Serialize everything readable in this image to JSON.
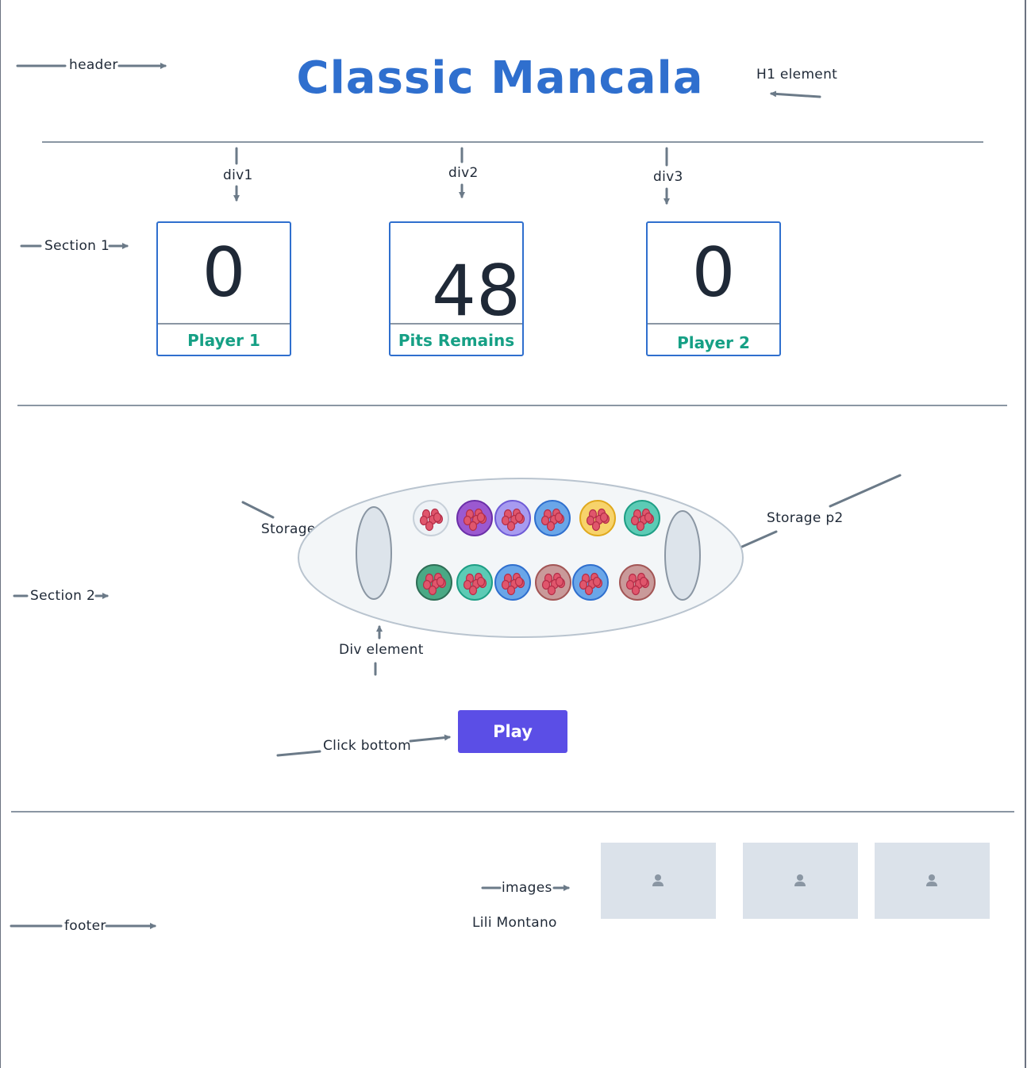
{
  "header": {
    "label": "header",
    "title": "Classic Mancala",
    "title_annotation": "H1 element"
  },
  "section1": {
    "label": "Section 1",
    "cards": [
      {
        "annotation": "div1",
        "value": "0",
        "caption": "Player 1"
      },
      {
        "annotation": "div2",
        "value": "48",
        "caption": "Pits Remains"
      },
      {
        "annotation": "div3",
        "value": "0",
        "caption": "Player 2"
      }
    ]
  },
  "section2": {
    "label": "Section 2",
    "storage_p1": "Storage p1",
    "storage_p2": "Storage p2",
    "board_annotation": "Div element",
    "button_annotation": "Click bottom",
    "play_label": "Play",
    "top_row_pits": [
      "white",
      "purple",
      "lavender",
      "blue",
      "yellow",
      "teal"
    ],
    "bottom_row_pits": [
      "green",
      "teal",
      "blue",
      "rose",
      "blue",
      "rose"
    ]
  },
  "footer": {
    "label": "footer",
    "images_label": "images",
    "author": "Lili Montano",
    "image_icons": [
      "user-icon",
      "user-icon",
      "user-icon"
    ]
  },
  "colors": {
    "title": "#2f6fce",
    "card_border": "#2f6fce",
    "caption": "#16a085",
    "play_button": "#5b4ee6",
    "arrow": "#6b7a88",
    "pit_white": "#eef2f6",
    "pit_purple": "#9b59d0",
    "pit_lavender": "#a79bf0",
    "pit_blue": "#6aa6e8",
    "pit_yellow": "#f7d36b",
    "pit_teal": "#5ccbb5",
    "pit_green": "#4aa985",
    "pit_rose": "#c99a9a"
  }
}
